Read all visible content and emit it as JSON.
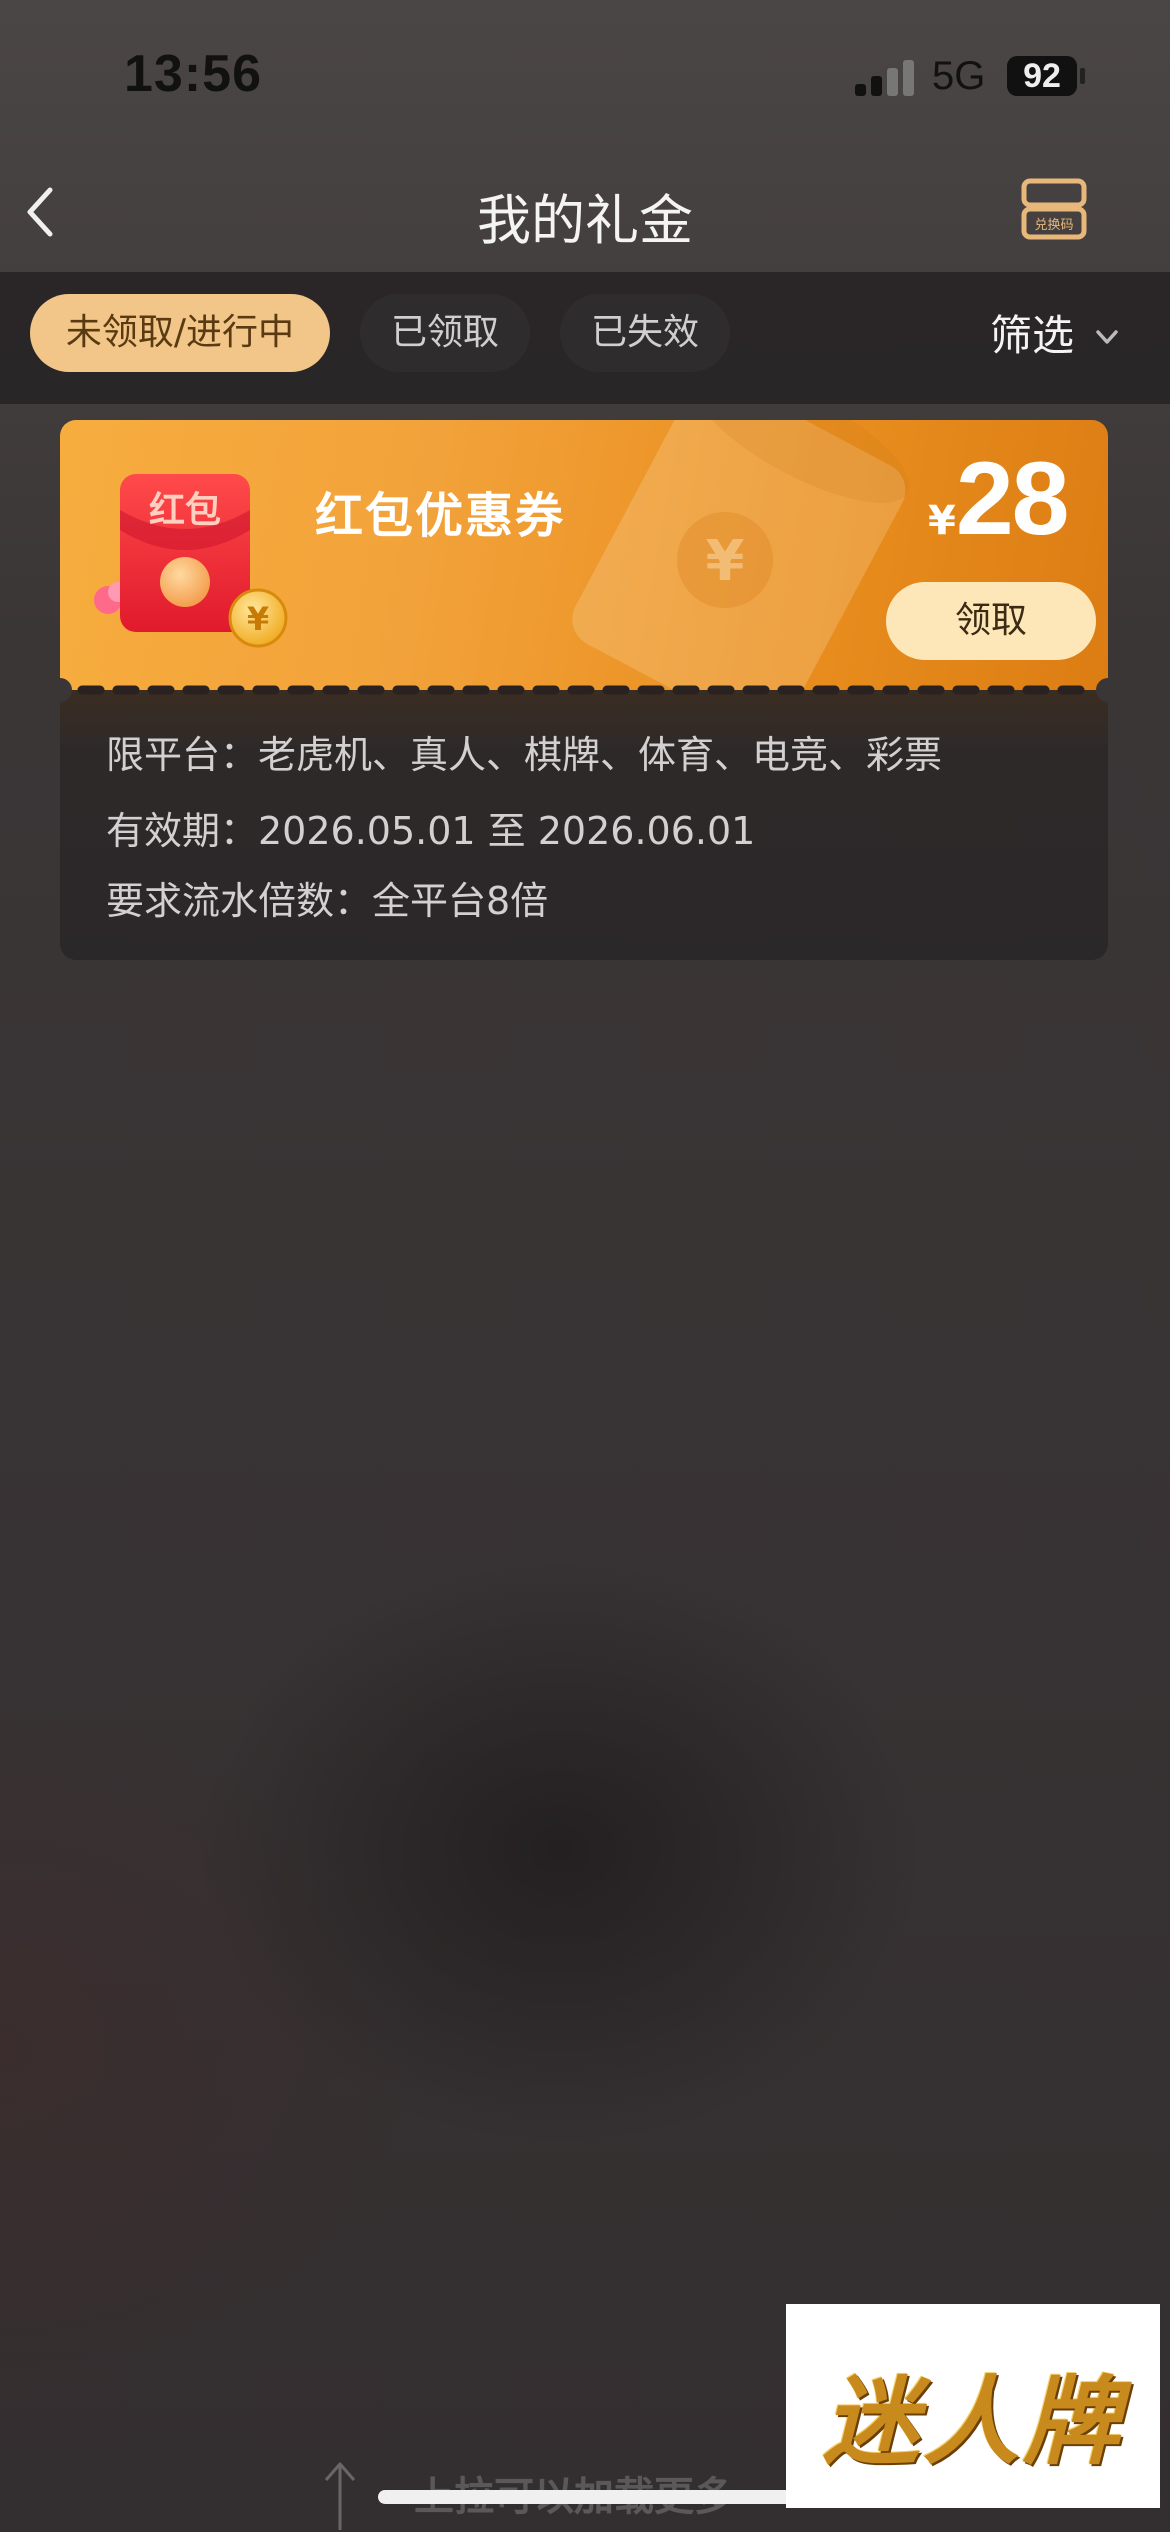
{
  "status_bar": {
    "time": "13:56",
    "network": "5G",
    "battery": "92"
  },
  "nav": {
    "title": "我的礼金",
    "redeem_icon_label": "兑换码"
  },
  "tabs": [
    {
      "label": "未领取/进行中",
      "active": true
    },
    {
      "label": "已领取",
      "active": false
    },
    {
      "label": "已失效",
      "active": false
    }
  ],
  "filter": {
    "label": "筛选"
  },
  "coupon": {
    "icon_label": "红包",
    "name": "红包优惠券",
    "currency": "¥",
    "amount": "28",
    "claim_label": "领取",
    "details": [
      "限平台：老虎机、真人、棋牌、体育、电竞、彩票",
      "有效期：2026.05.01 至 2026.06.01",
      "要求流水倍数：全平台8倍"
    ]
  },
  "footer": {
    "load_more": "上拉可以加载更多"
  },
  "watermark": {
    "text": "迷人牌"
  },
  "colors": {
    "accent": "#f1c688",
    "coupon_orange": "#f2a23a",
    "claim_button": "#fde7b8",
    "background": "#3b3636"
  }
}
